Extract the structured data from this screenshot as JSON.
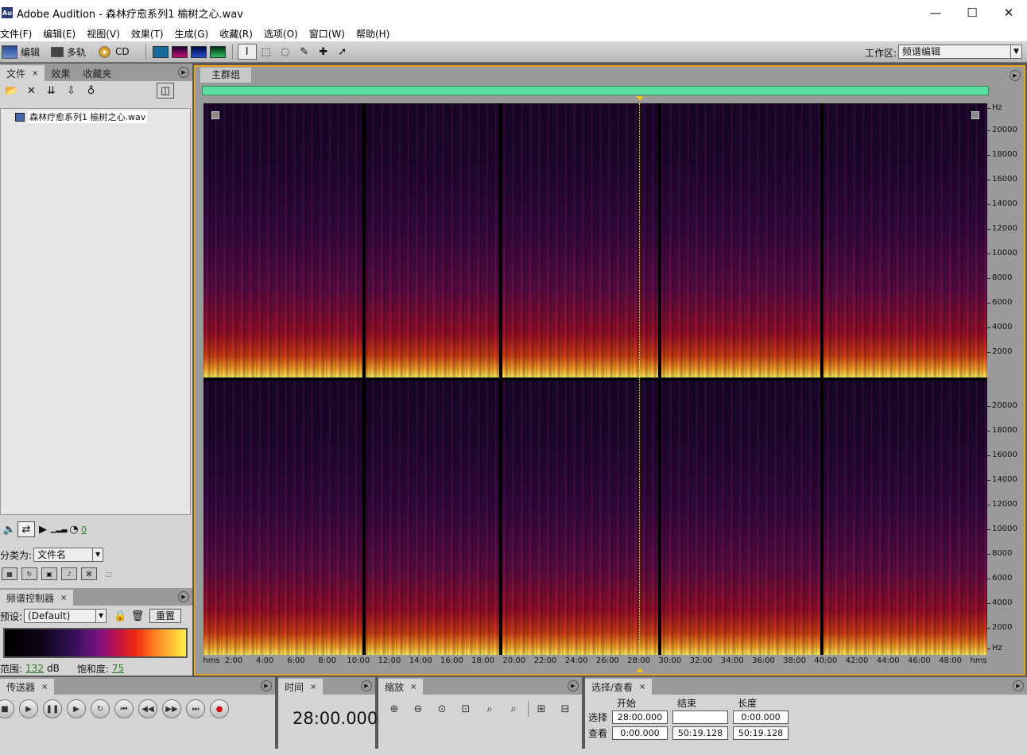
{
  "window": {
    "title": "Adobe Audition - 森林疗愈系列1 榆树之心.wav",
    "app_icon_text": "Au",
    "minimize": "—",
    "maximize": "☐",
    "close": "✕"
  },
  "menu": [
    "文件(F)",
    "编辑(E)",
    "视图(V)",
    "效果(T)",
    "生成(G)",
    "收藏(R)",
    "选项(O)",
    "窗口(W)",
    "帮助(H)"
  ],
  "toolbar": {
    "edit_label": "编辑",
    "multitrack_label": "多轨",
    "cd_label": "CD",
    "workspace_label": "工作区:",
    "workspace_value": "频谱编辑"
  },
  "files_panel": {
    "tabs": [
      "文件",
      "效果",
      "收藏夹"
    ],
    "close_x": "×",
    "files": [
      "森林疗愈系列1 榆树之心.wav"
    ],
    "volume_value": "0",
    "sort_label": "分类为:",
    "sort_value": "文件名"
  },
  "spectral_panel": {
    "tab": "频谱控制器",
    "preset_label": "预设:",
    "preset_value": "(Default)",
    "reset_label": "重置",
    "range_label": "范围:",
    "range_value": "132",
    "range_unit": "dB",
    "saturation_label": "饱和度:",
    "saturation_value": "75"
  },
  "main": {
    "tab": "主群组",
    "freq_unit": "Hz",
    "freq_ticks": [
      "20000",
      "18000",
      "16000",
      "14000",
      "12000",
      "10000",
      "8000",
      "6000",
      "4000",
      "2000"
    ],
    "time_unit": "hms",
    "time_ticks": [
      "2:00",
      "4:00",
      "6:00",
      "8:00",
      "10:00",
      "12:00",
      "14:00",
      "16:00",
      "18:00",
      "20:00",
      "22:00",
      "24:00",
      "26:00",
      "28:00",
      "30:00",
      "32:00",
      "34:00",
      "36:00",
      "38:00",
      "40:00",
      "42:00",
      "44:00",
      "46:00",
      "48:00"
    ],
    "cursor_time_minutes": 28,
    "total_minutes": 50.32
  },
  "transport": {
    "tab": "传送器",
    "buttons": [
      "■",
      "▶",
      "❚❚",
      "▶",
      "↻",
      "⏮",
      "◀◀",
      "▶▶",
      "⏭",
      "●"
    ]
  },
  "time_panel": {
    "tab": "时间",
    "value": "28:00.000"
  },
  "zoom_panel": {
    "tab": "缩放"
  },
  "selection_panel": {
    "tab": "选择/查看",
    "col_start": "开始",
    "col_end": "结束",
    "col_length": "长度",
    "row_selection": "选择",
    "row_view": "查看",
    "sel_start": "28:00.000",
    "sel_end": "",
    "sel_length": "0:00.000",
    "view_start": "0:00.000",
    "view_end": "50:19.128",
    "view_length": "50:19.128"
  }
}
